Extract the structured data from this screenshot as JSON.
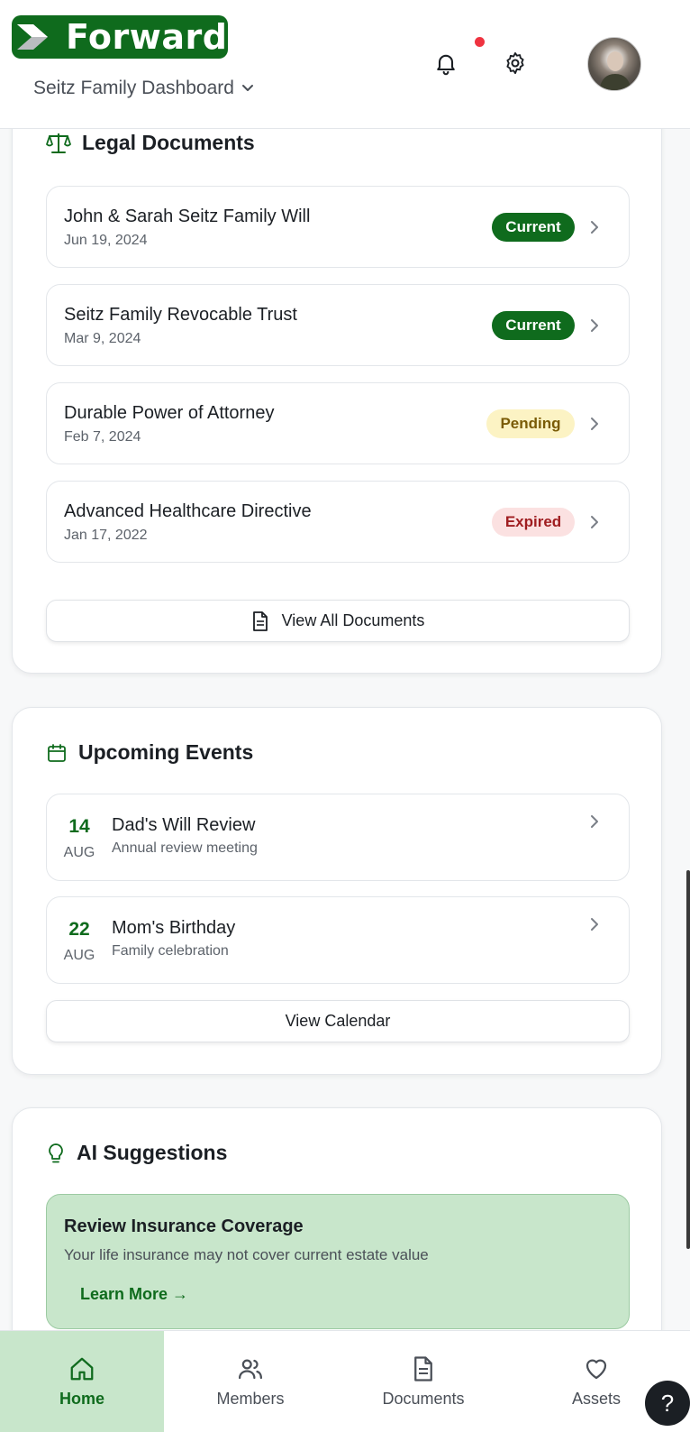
{
  "header": {
    "logo_text": "Forward",
    "dashboard_name": "Seitz Family Dashboard"
  },
  "legal": {
    "title": "Legal Documents",
    "documents": [
      {
        "name": "John & Sarah Seitz Family Will",
        "date": "Jun 19, 2024",
        "status": "Current"
      },
      {
        "name": "Seitz Family Revocable Trust",
        "date": "Mar 9, 2024",
        "status": "Current"
      },
      {
        "name": "Durable Power of Attorney",
        "date": "Feb 7, 2024",
        "status": "Pending"
      },
      {
        "name": "Advanced Healthcare Directive",
        "date": "Jan 17, 2022",
        "status": "Expired"
      }
    ],
    "view_all_label": "View All Documents"
  },
  "events": {
    "title": "Upcoming Events",
    "items": [
      {
        "day": "14",
        "month": "AUG",
        "title": "Dad's Will Review",
        "subtitle": "Annual review meeting"
      },
      {
        "day": "22",
        "month": "AUG",
        "title": "Mom's Birthday",
        "subtitle": "Family celebration"
      }
    ],
    "view_calendar_label": "View Calendar"
  },
  "ai": {
    "title": "AI Suggestions",
    "suggestion": {
      "title": "Review Insurance Coverage",
      "body": "Your life insurance may not cover current estate value",
      "action": "Learn More →"
    }
  },
  "nav": {
    "items": [
      {
        "label": "Home",
        "icon": "home-icon",
        "active": true
      },
      {
        "label": "Members",
        "icon": "users-icon",
        "active": false
      },
      {
        "label": "Documents",
        "icon": "document-icon",
        "active": false
      },
      {
        "label": "Assets",
        "icon": "heart-icon",
        "active": false
      }
    ]
  },
  "help": {
    "label": "?"
  },
  "colors": {
    "brand_green": "#0f6b1d",
    "light_green": "#c8e6cb",
    "notification_dot": "#ef3340"
  }
}
